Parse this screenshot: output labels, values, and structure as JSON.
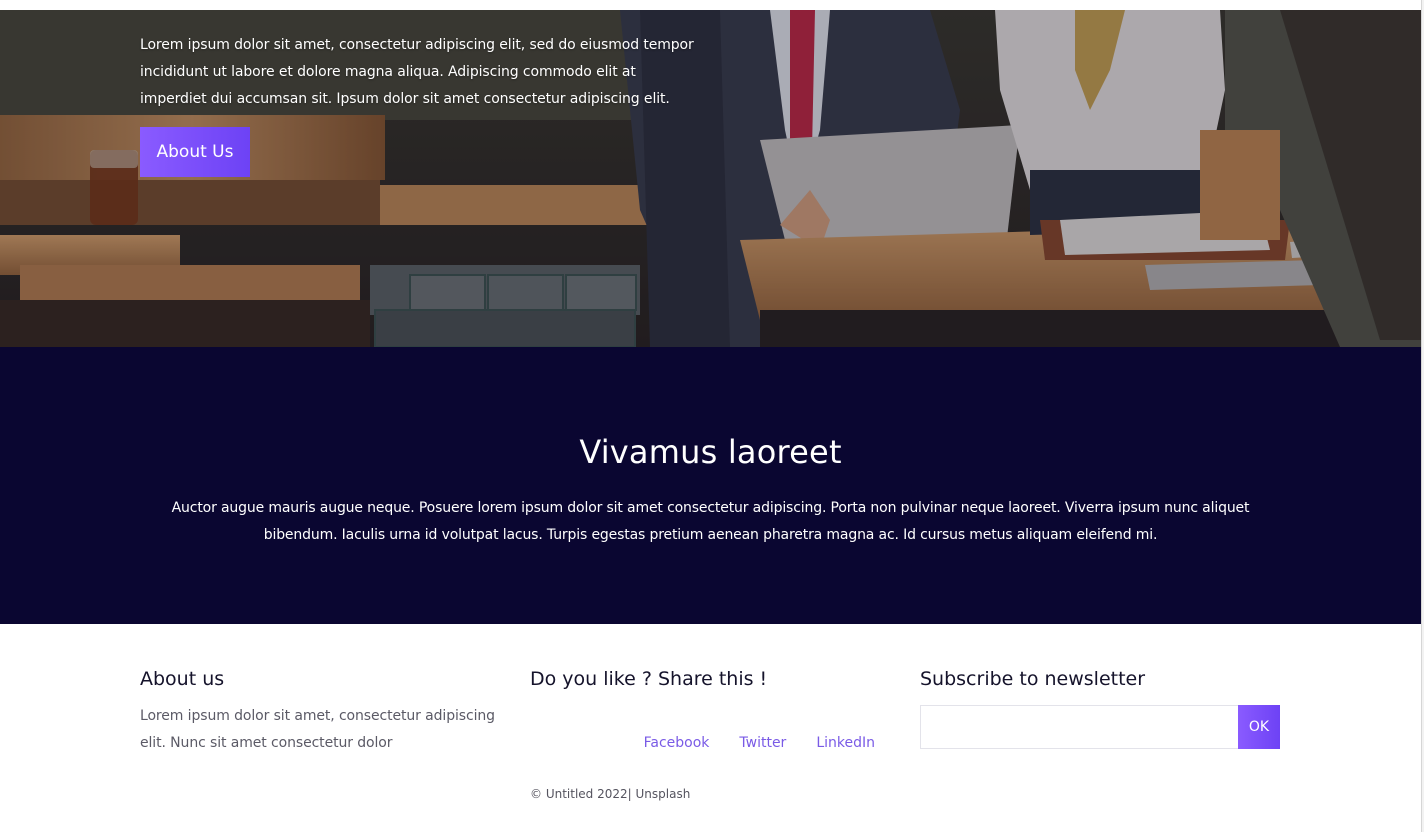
{
  "hero": {
    "text": "Lorem ipsum dolor sit amet, consectetur adipiscing elit, sed do eiusmod tempor incididunt ut labore et dolore magna aliqua. Adipiscing commodo elit at imperdiet dui accumsan sit. Ipsum dolor sit amet consectetur adipiscing elit.",
    "button_label": "About Us"
  },
  "feature": {
    "title": "Vivamus laoreet",
    "body": "Auctor augue mauris augue neque. Posuere lorem ipsum dolor sit amet consectetur adipiscing. Porta non pulvinar neque laoreet. Viverra ipsum nunc aliquet bibendum. Iaculis urna id volutpat lacus. Turpis egestas pretium aenean pharetra magna ac. Id cursus metus aliquam eleifend mi."
  },
  "footer": {
    "about": {
      "title": "About us",
      "text": "Lorem ipsum dolor sit amet, consectetur adipiscing elit. Nunc sit amet consectetur dolor"
    },
    "share": {
      "title": "Do you like ? Share this !",
      "links": [
        "Facebook",
        "Twitter",
        "LinkedIn"
      ]
    },
    "newsletter": {
      "title": "Subscribe to newsletter",
      "input_value": "",
      "button_label": "OK"
    },
    "copyright": "© Untitled 2022| Unsplash"
  },
  "colors": {
    "accent": "#7a5be6",
    "button_gradient_start": "#8a5bff",
    "button_gradient_end": "#6d42f5",
    "dark_section_bg": "#0a0631"
  }
}
